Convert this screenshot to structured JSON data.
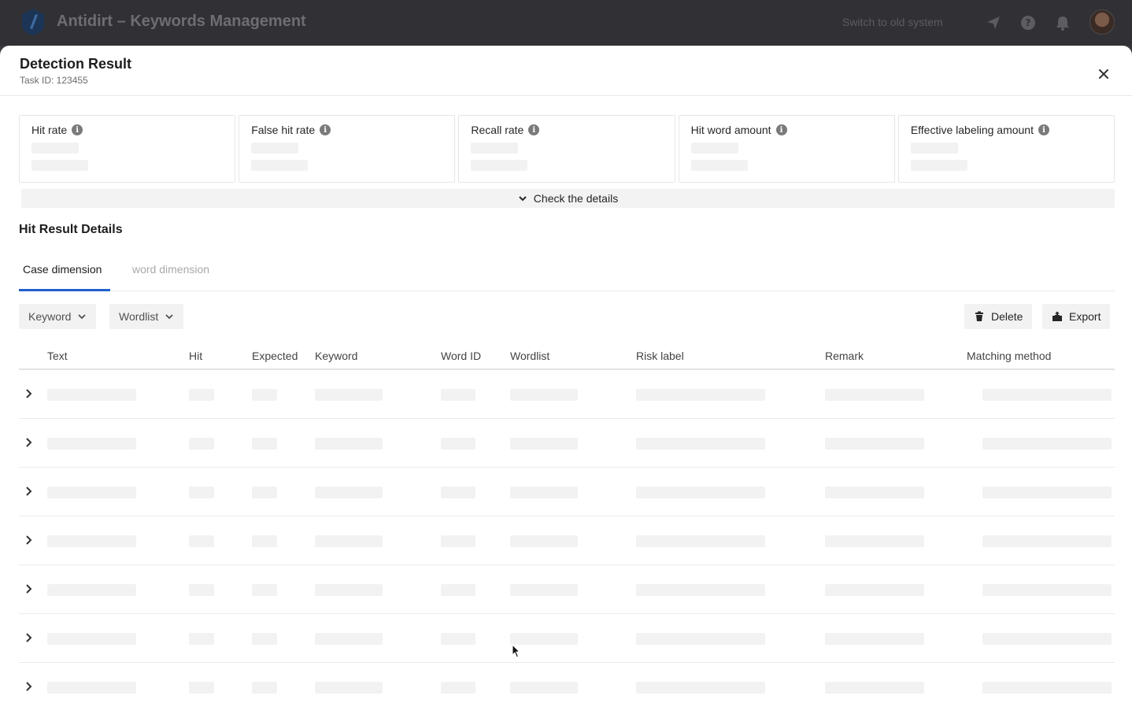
{
  "app": {
    "title": "Antidirt – Keywords Management",
    "switch_label": "Switch to old system"
  },
  "drawer": {
    "title": "Detection Result",
    "task_id": "Task ID:  123455"
  },
  "metrics": [
    {
      "label": "Hit rate"
    },
    {
      "label": "False hit rate"
    },
    {
      "label": "Recall rate"
    },
    {
      "label": "Hit word amount"
    },
    {
      "label": "Effective labeling amount"
    }
  ],
  "details_toggle": "Check the details",
  "section_title": "Hit Result Details",
  "tabs": [
    {
      "label": "Case dimension",
      "active": true
    },
    {
      "label": "word dimension",
      "active": false
    }
  ],
  "filters": {
    "keyword": "Keyword",
    "wordlist": "Wordlist"
  },
  "actions": {
    "delete": "Delete",
    "export": "Export"
  },
  "table": {
    "columns": [
      "Text",
      "Hit",
      "Expected",
      "Keyword",
      "Word ID",
      "Wordlist",
      "Risk label",
      "Remark",
      "Matching method"
    ],
    "loading_rows": 7
  }
}
